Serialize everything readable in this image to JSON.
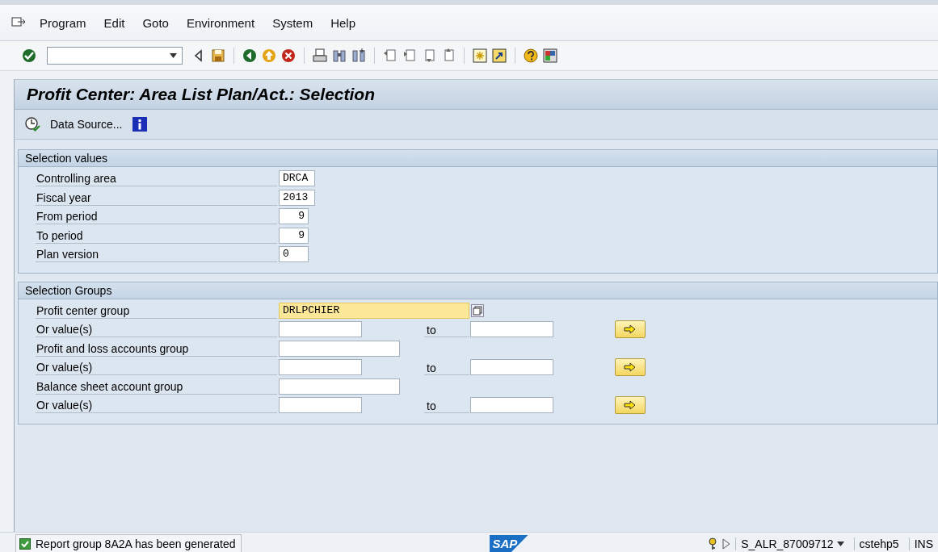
{
  "menu": [
    {
      "label": "Program"
    },
    {
      "label": "Edit"
    },
    {
      "label": "Goto"
    },
    {
      "label": "Environment"
    },
    {
      "label": "System"
    },
    {
      "label": "Help"
    }
  ],
  "title": "Profit Center: Area List Plan/Act.: Selection",
  "app_toolbar": {
    "button": "Data Source..."
  },
  "selection_values": {
    "title": "Selection values",
    "rows": [
      {
        "label": "Controlling area",
        "value": "DRCA"
      },
      {
        "label": "Fiscal year",
        "value": "2013"
      },
      {
        "label": "From period",
        "value": "9"
      },
      {
        "label": "To period",
        "value": "9"
      },
      {
        "label": "Plan version",
        "value": "0"
      }
    ]
  },
  "selection_groups": {
    "title": "Selection Groups",
    "rows": [
      {
        "kind": "group",
        "label": "Profit center group",
        "value": "DRLPCHIER",
        "focused": true
      },
      {
        "kind": "range",
        "label": "Or value(s)",
        "to_label": "to"
      },
      {
        "kind": "group",
        "label": "Profit and loss accounts group",
        "focused": false
      },
      {
        "kind": "range",
        "label": "Or value(s)",
        "to_label": "to"
      },
      {
        "kind": "group",
        "label": "Balance sheet account group",
        "focused": false
      },
      {
        "kind": "range",
        "label": "Or value(s)",
        "to_label": "to"
      }
    ]
  },
  "status_bar": {
    "kind": "success",
    "message": "Report group 8A2A has been generated",
    "program": "S_ALR_87009712",
    "user": "cstehp5",
    "mode": "INS",
    "logo": "SAP"
  }
}
